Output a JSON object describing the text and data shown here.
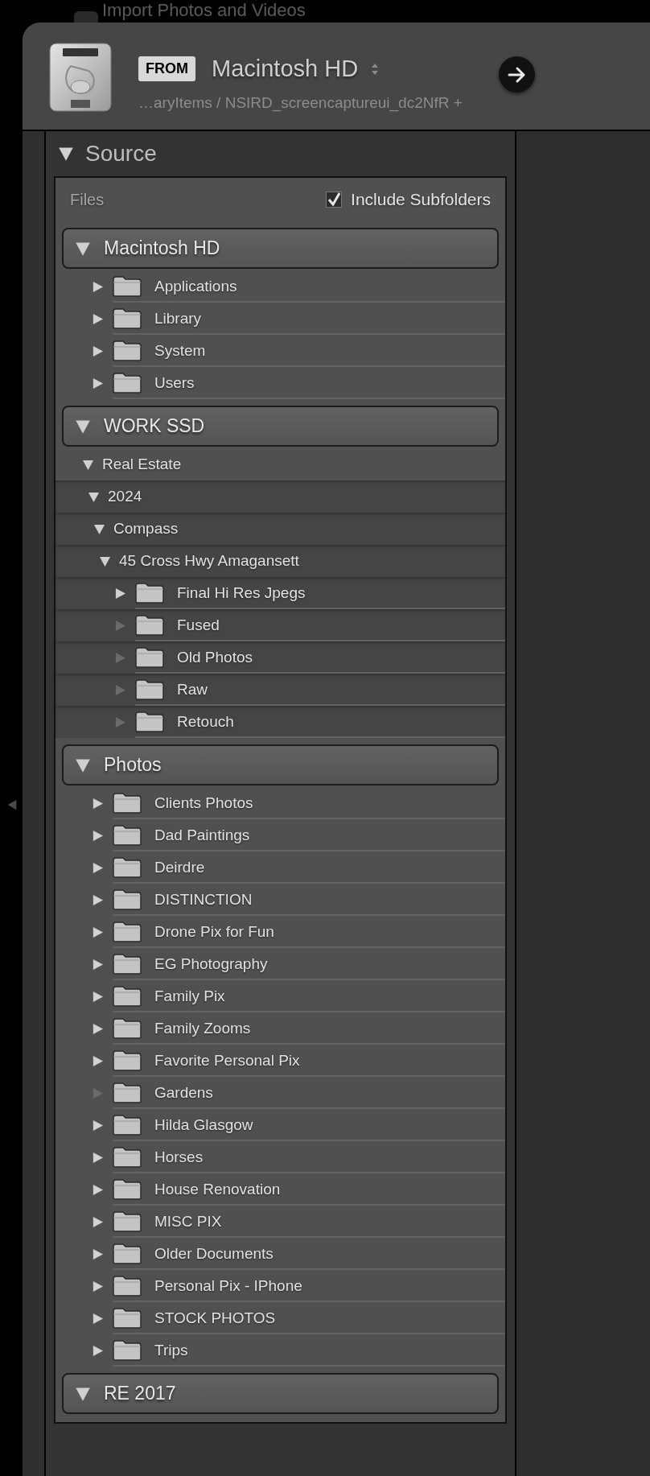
{
  "background_window": {
    "title": "Import Photos and Videos"
  },
  "header": {
    "from_badge": "FROM",
    "source_name": "Macintosh HD",
    "path": "…aryItems / NSIRD_screencaptureui_dc2NfR +"
  },
  "source": {
    "title": "Source",
    "expanded": true,
    "files_label": "Files",
    "include_subfolders": {
      "label": "Include Subfolders",
      "checked": true
    },
    "volumes": [
      {
        "name": "Macintosh HD",
        "expanded": true,
        "folders": [
          {
            "name": "Applications",
            "has_children": true,
            "expanded": false
          },
          {
            "name": "Library",
            "has_children": true,
            "expanded": false
          },
          {
            "name": "System",
            "has_children": true,
            "expanded": false
          },
          {
            "name": "Users",
            "has_children": true,
            "expanded": false
          }
        ]
      },
      {
        "name": "WORK SSD",
        "expanded": true,
        "folders": [
          {
            "name": "Real Estate",
            "has_children": true,
            "expanded": true,
            "children": [
              {
                "name": "2024",
                "has_children": true,
                "expanded": true,
                "children": [
                  {
                    "name": "Compass",
                    "has_children": true,
                    "expanded": true,
                    "children": [
                      {
                        "name": "45 Cross Hwy Amagansett",
                        "has_children": true,
                        "expanded": true,
                        "children": [
                          {
                            "name": "Final Hi Res Jpegs",
                            "has_children": true,
                            "expanded": false
                          },
                          {
                            "name": "Fused",
                            "has_children": false,
                            "expanded": false
                          },
                          {
                            "name": "Old Photos",
                            "has_children": false,
                            "expanded": false
                          },
                          {
                            "name": "Raw",
                            "has_children": false,
                            "expanded": false
                          },
                          {
                            "name": "Retouch",
                            "has_children": false,
                            "expanded": false
                          }
                        ]
                      }
                    ]
                  }
                ]
              }
            ]
          }
        ]
      },
      {
        "name": "Photos",
        "expanded": true,
        "folders": [
          {
            "name": "Clients Photos",
            "has_children": true,
            "expanded": false
          },
          {
            "name": "Dad Paintings",
            "has_children": true,
            "expanded": false
          },
          {
            "name": "Deirdre",
            "has_children": true,
            "expanded": false
          },
          {
            "name": "DISTINCTION",
            "has_children": true,
            "expanded": false
          },
          {
            "name": "Drone Pix  for Fun",
            "has_children": true,
            "expanded": false
          },
          {
            "name": "EG Photography",
            "has_children": true,
            "expanded": false
          },
          {
            "name": "Family Pix",
            "has_children": true,
            "expanded": false
          },
          {
            "name": "Family Zooms",
            "has_children": true,
            "expanded": false
          },
          {
            "name": "Favorite Personal Pix",
            "has_children": true,
            "expanded": false
          },
          {
            "name": "Gardens",
            "has_children": false,
            "expanded": false
          },
          {
            "name": "Hilda Glasgow",
            "has_children": true,
            "expanded": false
          },
          {
            "name": "Horses",
            "has_children": true,
            "expanded": false
          },
          {
            "name": "House Renovation",
            "has_children": true,
            "expanded": false
          },
          {
            "name": "MISC PIX",
            "has_children": true,
            "expanded": false
          },
          {
            "name": "Older Documents",
            "has_children": true,
            "expanded": false
          },
          {
            "name": "Personal Pix - IPhone",
            "has_children": true,
            "expanded": false
          },
          {
            "name": "STOCK PHOTOS",
            "has_children": true,
            "expanded": false
          },
          {
            "name": "Trips",
            "has_children": true,
            "expanded": false
          }
        ]
      },
      {
        "name": "RE 2017",
        "expanded": true
      }
    ]
  }
}
